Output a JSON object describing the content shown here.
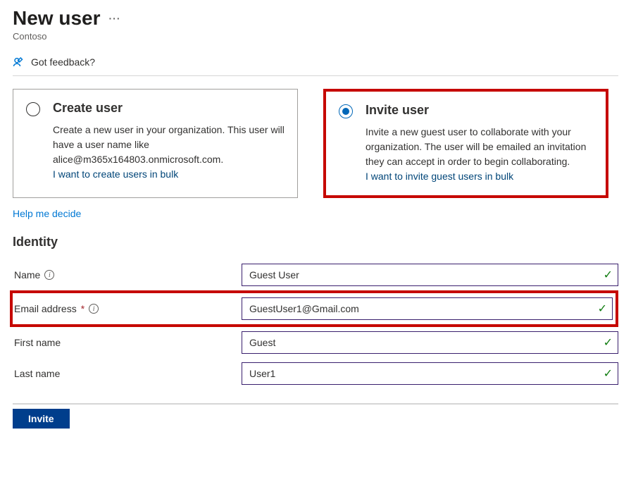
{
  "header": {
    "title": "New user",
    "subtitle": "Contoso",
    "more_label": "···"
  },
  "feedback": {
    "label": "Got feedback?"
  },
  "options": {
    "create": {
      "title": "Create user",
      "desc": "Create a new user in your organization. This user will have a user name like alice@m365x164803.onmicrosoft.com.",
      "link": "I want to create users in bulk"
    },
    "invite": {
      "title": "Invite user",
      "desc": "Invite a new guest user to collaborate with your organization. The user will be emailed an invitation they can accept in order to begin collaborating.",
      "link": "I want to invite guest users in bulk"
    }
  },
  "help_link": "Help me decide",
  "identity": {
    "heading": "Identity",
    "fields": {
      "name": {
        "label": "Name",
        "value": "Guest User"
      },
      "email": {
        "label": "Email address",
        "value": "GuestUser1@Gmail.com"
      },
      "first": {
        "label": "First name",
        "value": "Guest"
      },
      "last": {
        "label": "Last name",
        "value": "User1"
      }
    }
  },
  "footer": {
    "invite_label": "Invite"
  }
}
